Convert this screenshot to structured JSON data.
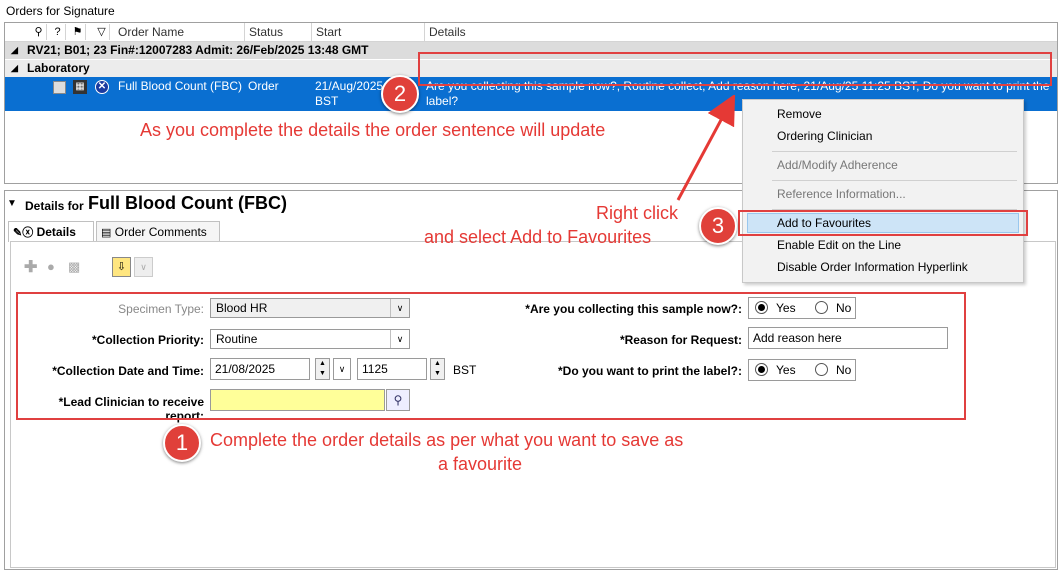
{
  "orders": {
    "title": "Orders for Signature",
    "columns": [
      "Order Name",
      "Status",
      "Start",
      "Details"
    ],
    "header_icons": [
      "pin-icon",
      "help-icon",
      "flag-icon",
      "filter-icon"
    ],
    "encounter": "RV21; B01; 23  Fin#:12007283  Admit: 26/Feb/2025 13:48 GMT",
    "group": "Laboratory",
    "row": {
      "name": "Full Blood Count (FBC)",
      "status": "Order",
      "start_line1": "21/Aug/2025",
      "start_line2": "BST",
      "details_line1": "Are you collecting this sample now?, Routine collect, Add reason here, 21/Aug/25 11:25 BST, Do you want to print the",
      "details_line2": "label?"
    }
  },
  "annotations": {
    "a1": "Complete the order details as per what you want to save as",
    "a1b": "a favourite",
    "a2": "As you complete the details the order sentence will update",
    "a3a": "Right click",
    "a3b": "and select Add to Favourites",
    "badge1": "1",
    "badge2": "2",
    "badge3": "3",
    "color": "#e53935"
  },
  "context_menu": {
    "items": [
      "Remove",
      "Ordering Clinician",
      "Add/Modify Adherence",
      "Reference Information...",
      "Add to Favourites",
      "Enable Edit on the Line",
      "Disable Order Information Hyperlink"
    ],
    "selected": "Add to Favourites"
  },
  "details": {
    "prefix": "Details for",
    "title": "Full Blood Count (FBC)",
    "tabs": [
      "Details",
      "Order Comments"
    ],
    "form": {
      "specimen_type_label": "Specimen Type:",
      "specimen_type_value": "Blood HR",
      "priority_label": "*Collection Priority:",
      "priority_value": "Routine",
      "date_label": "*Collection Date and Time:",
      "date_value": "21/08/2025",
      "time_value": "1125",
      "tz": "BST",
      "clinician_label": "*Lead Clinician to receive report:",
      "clinician_value": "",
      "collecting_label": "*Are you collecting this sample now?:",
      "reason_label": "*Reason for Request:",
      "reason_value": "Add reason here",
      "print_label": "*Do you want to print the label?:",
      "yes": "Yes",
      "no": "No"
    }
  }
}
